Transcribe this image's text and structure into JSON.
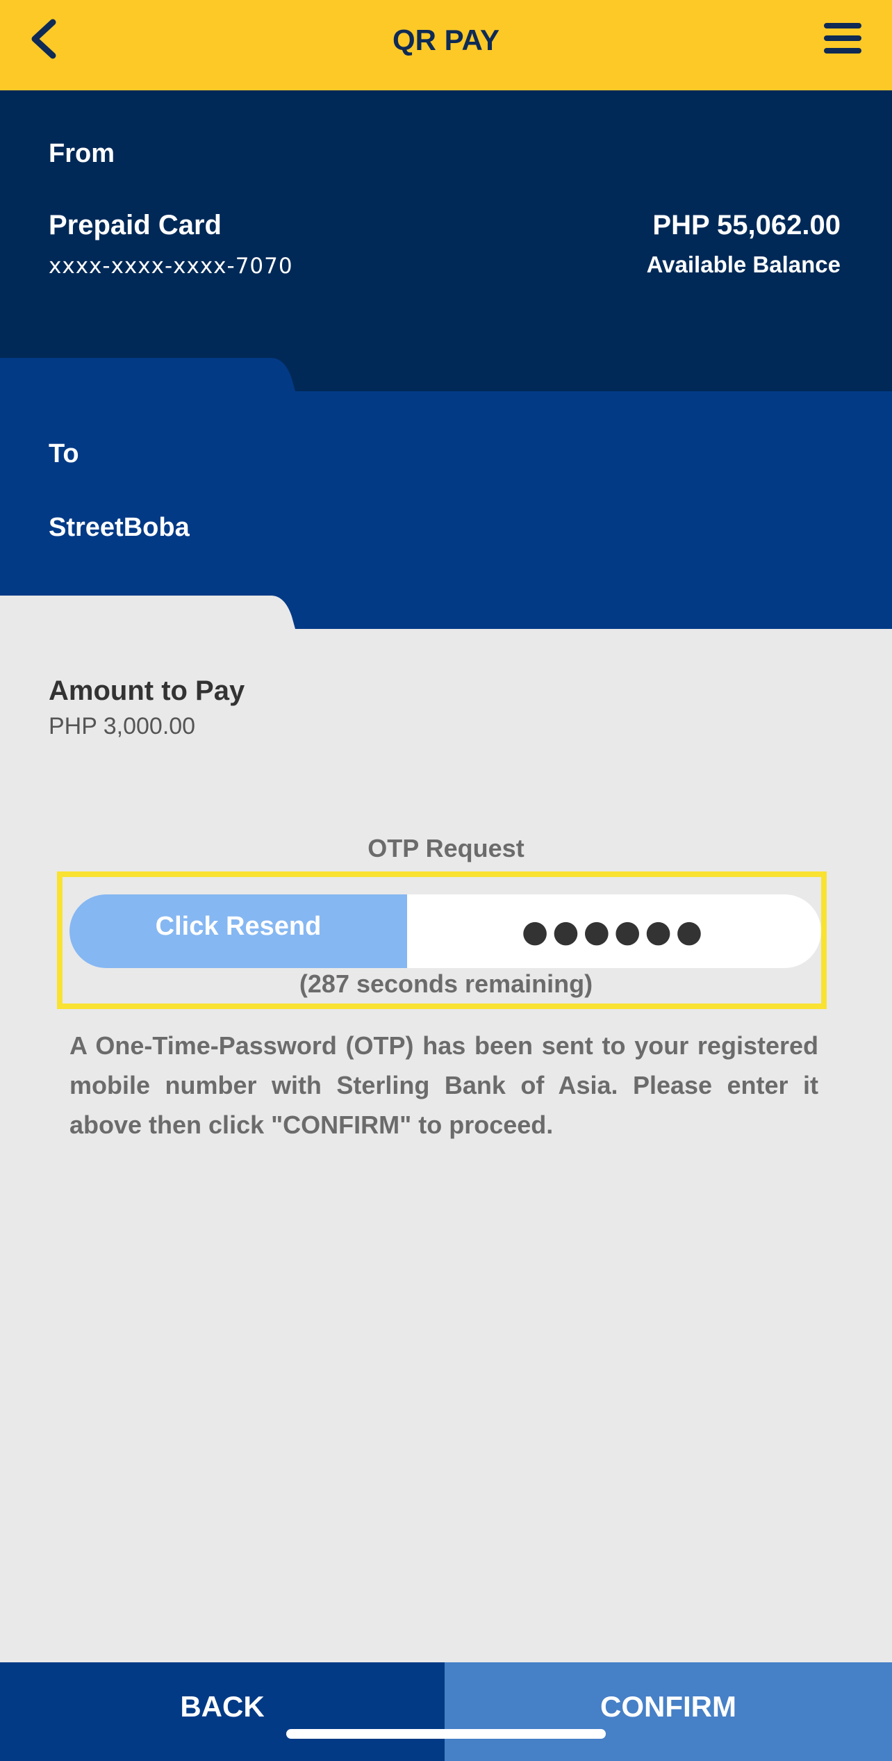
{
  "header": {
    "title": "QR PAY",
    "back_icon": "chevron-left-icon",
    "menu_icon": "hamburger-menu-icon",
    "color": "#fcc927"
  },
  "from": {
    "label": "From",
    "account_name": "Prepaid Card",
    "account_number": "xxxx-xxxx-xxxx-7070",
    "balance": "PHP 55,062.00",
    "balance_label": "Available Balance"
  },
  "to": {
    "label": "To",
    "merchant": "StreetBoba"
  },
  "amount": {
    "label": "Amount to Pay",
    "value": "PHP 3,000.00"
  },
  "otp": {
    "title": "OTP Request",
    "resend_label": "Click Resend",
    "input_value": "●●●●●●",
    "timer": "(287 seconds remaining)",
    "note": "A One-Time-Password (OTP) has been sent to your registered mobile number with Sterling Bank of Asia. Please enter it above then click \"CONFIRM\" to proceed."
  },
  "footer": {
    "back_label": "BACK",
    "confirm_label": "CONFIRM"
  },
  "colors": {
    "navy": "#012957",
    "blue": "#033a86",
    "resend": "#85b7f2",
    "confirm": "#4680c7",
    "highlight": "#f9e232"
  }
}
